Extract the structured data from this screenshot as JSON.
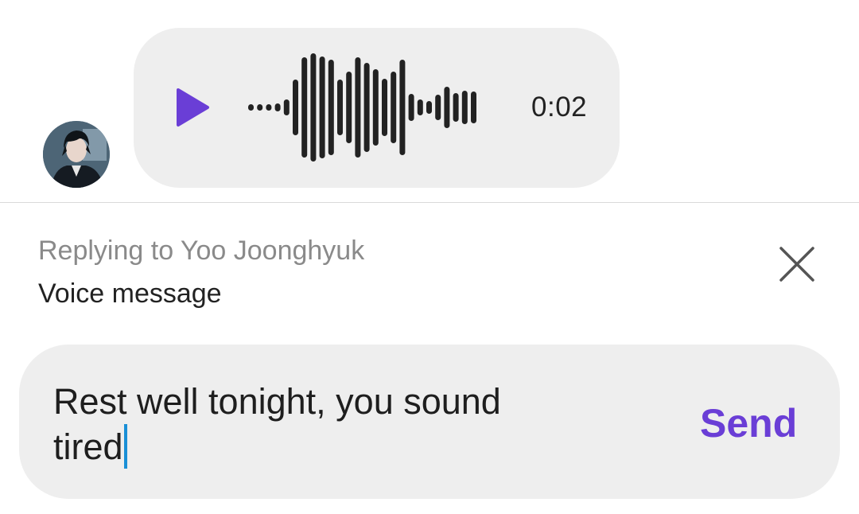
{
  "voice_message": {
    "duration": "0:02",
    "play_icon": "play-icon",
    "accent_color": "#6a3ed6"
  },
  "reply": {
    "replying_to": "Replying to Yoo Joonghyuk",
    "quoted": "Voice message",
    "close_icon": "close-icon"
  },
  "composer": {
    "text": "Rest well tonight, you sound tired",
    "send_label": "Send",
    "send_color": "#6a3ed6"
  }
}
